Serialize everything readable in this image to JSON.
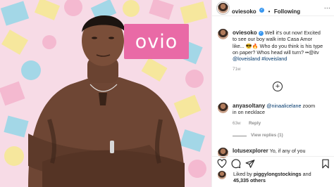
{
  "photo": {
    "brand_text": "ovio"
  },
  "post": {
    "username": "oviesoko",
    "follow_separator": "•",
    "follow_label": "Following",
    "more_label": "...",
    "caption_username": "oviesoko",
    "caption_lines": [
      "Well it's out now! Excited",
      "to see our boy walk into Casa Amor",
      "like... 😎🔥 Who do you think is his type",
      "on paper? Whos head will turn? ••@itv"
    ],
    "caption_tags": "@loveisland #loveisland",
    "caption_time": "71w",
    "load_more_symbol": "+",
    "comments": [
      {
        "username": "anyasoltany",
        "mention": "@ninaalicelane",
        "text_1": " zoom",
        "text_2": "in on necklace",
        "time": "63w",
        "reply": "Reply"
      }
    ],
    "view_replies": "View replies (1)",
    "partial_comment": {
      "username": "lotusexplorer",
      "text": "Yo, if any of you"
    },
    "likes_prefix": "Liked by ",
    "likes_user": "piggylongstockings",
    "likes_and": " and",
    "likes_count": "45,335 others"
  },
  "colors": {
    "brand_pink": "#e96aa6",
    "link_blue": "#00376b",
    "verified_blue": "#3897f0",
    "pastel_yellow": "#f6e89a",
    "pastel_blue": "#9fd7e8",
    "pastel_pink": "#f4b8cf"
  }
}
